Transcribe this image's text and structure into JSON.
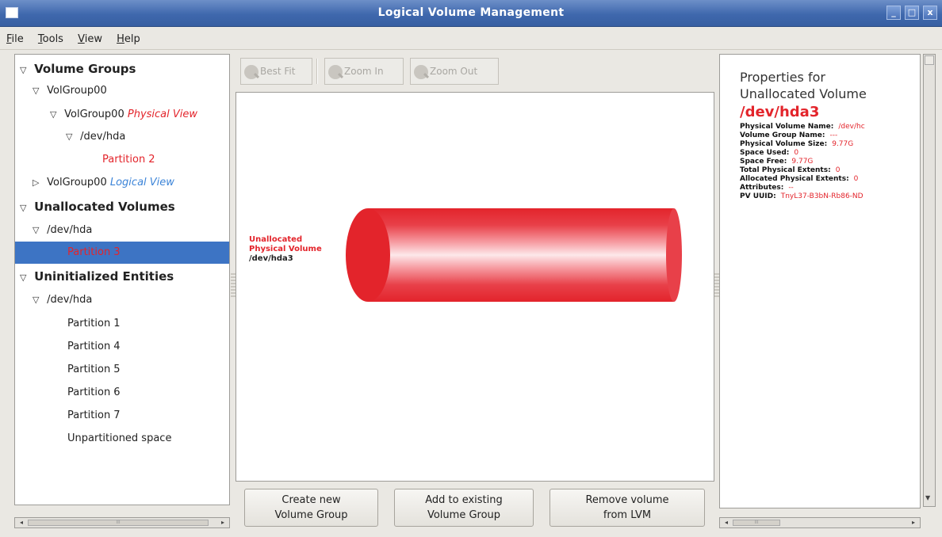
{
  "window": {
    "title": "Logical Volume Management",
    "buttons": [
      "_",
      "□",
      "x"
    ]
  },
  "menu": [
    {
      "label": "File",
      "mnemonic": "F",
      "rest": "ile"
    },
    {
      "label": "Tools",
      "mnemonic": "T",
      "rest": "ools"
    },
    {
      "label": "View",
      "mnemonic": "V",
      "rest": "iew"
    },
    {
      "label": "Help",
      "mnemonic": "H",
      "rest": "elp"
    }
  ],
  "tree": {
    "volume_groups": "Volume Groups",
    "volgroup": "VolGroup00",
    "volgroup_pv": "VolGroup00",
    "physical_view": "Physical View",
    "dev_hda_1": "/dev/hda",
    "partition2": "Partition 2",
    "volgroup_lv": "VolGroup00",
    "logical_view": "Logical View",
    "unallocated_volumes": "Unallocated Volumes",
    "dev_hda_2": "/dev/hda",
    "partition3": "Partition 3",
    "uninitialized_entities": "Uninitialized Entities",
    "dev_hda_3": "/dev/hda",
    "partition1": "Partition 1",
    "partition4": "Partition 4",
    "partition5": "Partition 5",
    "partition6": "Partition 6",
    "partition7": "Partition 7",
    "unpartitioned": "Unpartitioned space"
  },
  "toolbar": {
    "best_fit": "Best Fit",
    "zoom_in": "Zoom In",
    "zoom_out": "Zoom Out"
  },
  "canvas": {
    "label_line1": "Unallocated",
    "label_line2": "Physical Volume",
    "label_device": "/dev/hda3"
  },
  "buttons": {
    "create_line1": "Create new",
    "create_line2": "Volume Group",
    "add_line1": "Add to existing",
    "add_line2": "Volume Group",
    "remove_line1": "Remove volume",
    "remove_line2": "from LVM"
  },
  "properties": {
    "heading_line1": "Properties for",
    "heading_line2": "Unallocated Volume",
    "device": "/dev/hda3",
    "items": [
      {
        "key": "Physical Volume Name:",
        "value": "/dev/hc"
      },
      {
        "key": "Volume Group Name:",
        "value": "---"
      },
      {
        "key": "Physical Volume Size:",
        "value": "9.77G"
      },
      {
        "key": "Space Used:",
        "value": "0"
      },
      {
        "key": "Space Free:",
        "value": "9.77G"
      },
      {
        "key": "Total Physical Extents:",
        "value": "0"
      },
      {
        "key": "Allocated Physical Extents:",
        "value": "0"
      },
      {
        "key": "Attributes:",
        "value": "--"
      },
      {
        "key": "PV UUID:",
        "value": "TnyL37-B3bN-Rb86-ND"
      }
    ]
  },
  "colors": {
    "accent_red": "#e3242b",
    "selection": "#3d74c4",
    "title_blue": "#3f68ad",
    "logical_blue": "#3c84d8"
  },
  "scrollbar_glyph": "III"
}
